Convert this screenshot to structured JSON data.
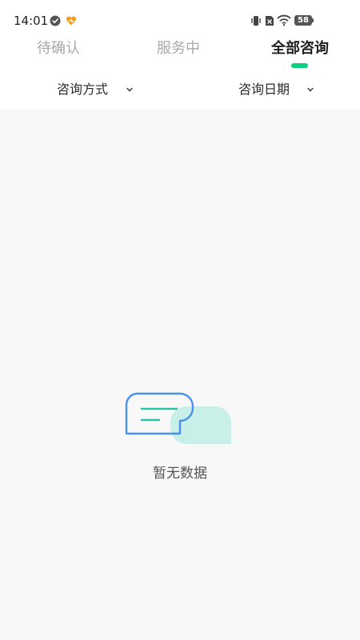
{
  "status_bar": {
    "time": "14:01",
    "battery": "58"
  },
  "tabs": [
    {
      "label": "待确认",
      "active": false
    },
    {
      "label": "服务中",
      "active": false
    },
    {
      "label": "全部咨询",
      "active": true
    }
  ],
  "filters": {
    "method_label": "咨询方式",
    "date_label": "咨询日期"
  },
  "empty": {
    "message": "暂无数据"
  },
  "colors": {
    "accent": "#0ecf7e",
    "bubble_blue": "#4a90f0",
    "bubble_teal": "#c8efe8",
    "line_teal": "#2bc4a8"
  }
}
